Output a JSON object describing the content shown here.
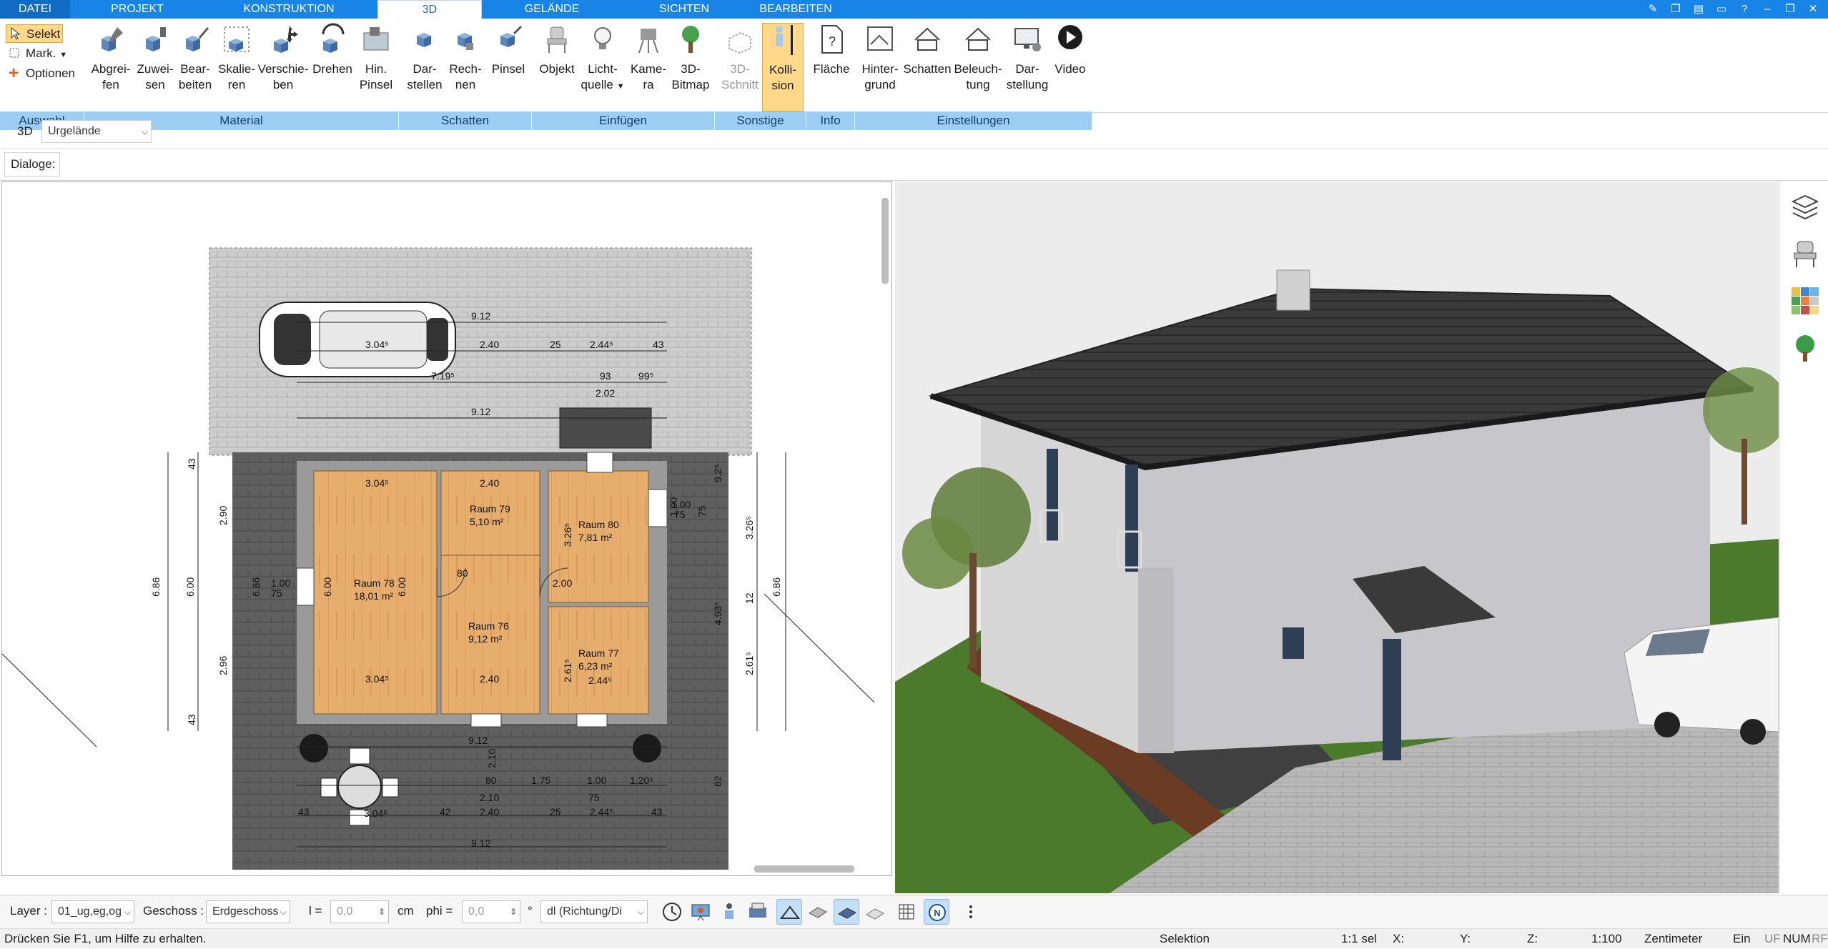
{
  "tabs": [
    {
      "label": "DATEI"
    },
    {
      "label": "PROJEKT"
    },
    {
      "label": "KONSTRUKTION"
    },
    {
      "label": "3D"
    },
    {
      "label": "GELÄNDE"
    },
    {
      "label": "SICHTEN"
    },
    {
      "label": "BEARBEITEN"
    }
  ],
  "selection": {
    "select": "Selekt",
    "mark": "Mark.",
    "options": "Optionen"
  },
  "ribbon": {
    "groups": [
      "Auswahl",
      "Material",
      "Schatten",
      "Einfügen",
      "Sonstige",
      "Info",
      "Einstellungen"
    ],
    "buttons": [
      {
        "l1": "Abgrei-",
        "l2": "fen"
      },
      {
        "l1": "Zuwei-",
        "l2": "sen"
      },
      {
        "l1": "Bear-",
        "l2": "beiten"
      },
      {
        "l1": "Skalie-",
        "l2": "ren"
      },
      {
        "l1": "Verschie-",
        "l2": "ben"
      },
      {
        "l1": "Drehen",
        "l2": ""
      },
      {
        "l1": "Hin.",
        "l2": "Pinsel"
      },
      {
        "l1": "Dar-",
        "l2": "stellen"
      },
      {
        "l1": "Rech-",
        "l2": "nen"
      },
      {
        "l1": "Pinsel",
        "l2": ""
      },
      {
        "l1": "Objekt",
        "l2": ""
      },
      {
        "l1": "Licht-",
        "l2": "quelle"
      },
      {
        "l1": "Kame-",
        "l2": "ra"
      },
      {
        "l1": "3D-",
        "l2": "Bitmap"
      },
      {
        "l1": "3D-",
        "l2": "Schnitt"
      },
      {
        "l1": "Kolli-",
        "l2": "sion"
      },
      {
        "l1": "Fläche",
        "l2": ""
      },
      {
        "l1": "Hinter-",
        "l2": "grund"
      },
      {
        "l1": "Schatten",
        "l2": ""
      },
      {
        "l1": "Beleuch-",
        "l2": "tung"
      },
      {
        "l1": "Dar-",
        "l2": "stellung"
      },
      {
        "l1": "Video",
        "l2": ""
      }
    ]
  },
  "bar3d": {
    "mode": "3D",
    "terrain": "Urgelände"
  },
  "dialog_label": "Dialoge:",
  "plan": {
    "dims": [
      "9.12",
      "2.40",
      "25",
      "2.44⁵",
      "43",
      "3.04⁵",
      "7.19⁵",
      "93",
      "99⁵",
      "2.02",
      "9.12",
      "6.86",
      "6.00",
      "6.86",
      "6.86",
      "43",
      "2.90",
      "2.96",
      "43",
      "1.00",
      "75",
      "3.04⁵",
      "2.40",
      "2.40",
      "3.04⁵",
      "2.44⁵",
      "6.00",
      "6.00",
      "3.26⁵",
      "2.61⁵",
      "75",
      "1.00",
      "1.00",
      "75",
      "80",
      "2.00",
      "2.10",
      "9.12",
      "1.75",
      "1.00",
      "75",
      "1.20⁵",
      "80",
      "2.10",
      "43",
      "42",
      "2.40",
      "25",
      "2.44⁵",
      "43",
      "3.04⁵",
      "9.12",
      "12",
      "4.93⁵",
      "9.2⁵",
      "62",
      "2.61⁵",
      "3.26⁵"
    ],
    "rooms": [
      {
        "name": "Raum 78",
        "area": "18,01 m²"
      },
      {
        "name": "Raum 79",
        "area": "5,10 m²"
      },
      {
        "name": "Raum 80",
        "area": "7,81 m²"
      },
      {
        "name": "Raum 76",
        "area": "9,12 m²"
      },
      {
        "name": "Raum 77",
        "area": "6,23 m²"
      }
    ]
  },
  "bottom": {
    "layer_label": "Layer :",
    "layer_value": "01_ug,eg,og",
    "floor_label": "Geschoss :",
    "floor_value": "Erdgeschoss",
    "l_label": "l =",
    "l_value": "0,0",
    "l_unit": "cm",
    "phi_label": "phi =",
    "phi_value": "0,0",
    "phi_unit": "°",
    "dir_value": "dl (Richtung/Di"
  },
  "status": {
    "help": "Drücken Sie F1, um Hilfe zu erhalten.",
    "mode": "Selektion",
    "sel": "1:1 sel",
    "x": "X:",
    "y": "Y:",
    "z": "Z:",
    "scale": "1:100",
    "unit": "Zentimeter",
    "ein": "Ein",
    "uf": "UF",
    "num": "NUM",
    "rf": "RF"
  },
  "colors": {
    "tabbar": "#1884e6",
    "groupbar": "#9ecdf3",
    "active": "#ffd889",
    "floor": "#e6a95f",
    "roof": "#3a3a3a",
    "grass": "#4c7a2b"
  }
}
